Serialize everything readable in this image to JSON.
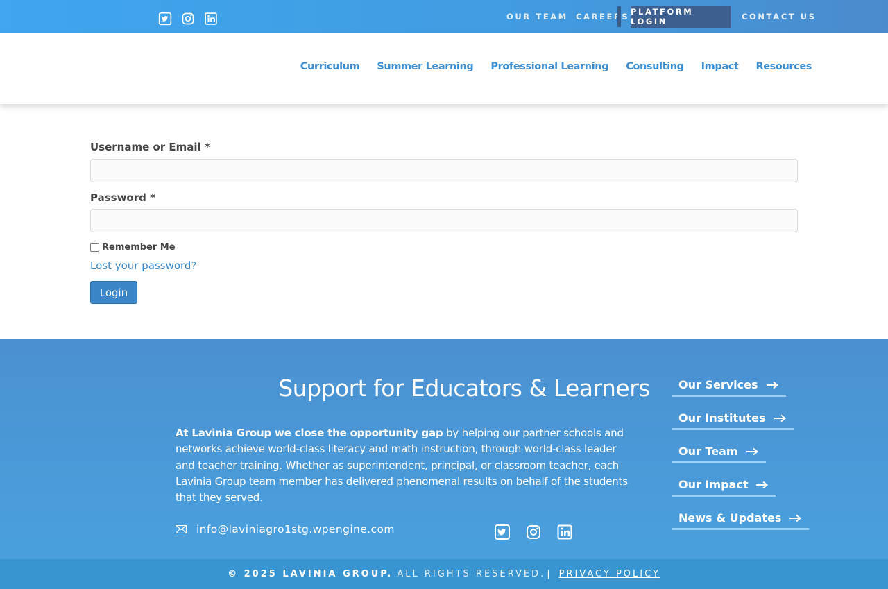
{
  "topbar": {
    "social_icons": [
      "twitter-icon",
      "instagram-icon",
      "linkedin-icon"
    ],
    "links": {
      "our_team": "OUR TEAM",
      "careers": "CAREERS",
      "platform_login": "PLATFORM LOGIN",
      "contact_us": "CONTACT US"
    }
  },
  "nav": {
    "items": [
      "Curriculum",
      "Summer Learning",
      "Professional Learning",
      "Consulting",
      "Impact",
      "Resources"
    ]
  },
  "login_form": {
    "username_label": "Username or Email *",
    "username_value": "",
    "password_label": "Password *",
    "password_value": "",
    "remember_label": "Remember Me",
    "remember_checked": false,
    "lost_password": "Lost your password?",
    "login_button": "Login"
  },
  "footer": {
    "title": "Support for Educators & Learners",
    "intro_bold": "At Lavinia Group we close the opportunity gap",
    "intro_rest": " by helping our partner schools and networks achieve world-class literacy and math instruction, through world-class leader and teacher training.  Whether as superintendent, principal, or classroom teacher, each Lavinia Group team member has delivered phenomenal results on behalf of the students that they served.",
    "email": "info@laviniagro1stg.wpengine.com",
    "links": [
      "Our Services",
      "Our Institutes",
      "Our Team",
      "Our Impact",
      "News & Updates"
    ]
  },
  "copyright": {
    "owner": "© 2025 LAVINIA GROUP.",
    "rights": "ALL RIGHTS RESERVED.",
    "separator": "|",
    "privacy": "PRIVACY POLICY"
  },
  "colors": {
    "topbar": "#42a0e8",
    "nav_link": "#3f8fd0",
    "login_highlight": "#3d5f8f",
    "footer": "#4a98d8",
    "copyright_bar": "#3895d2",
    "button": "#3a86c8"
  }
}
